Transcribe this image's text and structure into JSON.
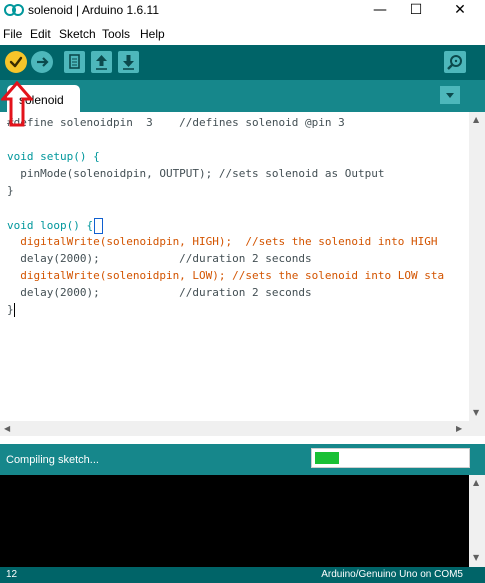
{
  "window": {
    "title": "solenoid | Arduino 1.6.11",
    "minimize_glyph": "—",
    "maximize_glyph": "☐",
    "close_glyph": "✕"
  },
  "menu": {
    "file": "File",
    "edit": "Edit",
    "sketch": "Sketch",
    "tools": "Tools",
    "help": "Help"
  },
  "toolbar": {
    "icons": [
      "checkmark-icon",
      "arrow-right-icon",
      "new-file-icon",
      "open-up-arrow-icon",
      "save-down-arrow-icon",
      "magnifier-icon"
    ]
  },
  "tabs": [
    {
      "label": "solenoid"
    }
  ],
  "editor": {
    "lines": [
      "#define solenoidpin  3    //defines solenoid @pin 3",
      "",
      "void setup() {",
      "  pinMode(solenoidpin, OUTPUT); //sets solenoid as Output",
      "}",
      "",
      "void loop() {",
      "  digitalWrite(solenoidpin, HIGH);  //sets the solenoid into HIGH",
      "  delay(2000);            //duration 2 seconds",
      "  digitalWrite(solenoidpin, LOW); //sets the solenoid into LOW sta",
      "  delay(2000);            //duration 2 seconds",
      "}"
    ]
  },
  "status": {
    "message": "Compiling sketch...",
    "progress": 0.16
  },
  "footer": {
    "line_number": "12",
    "board": "Arduino/Genuino Uno on COM5"
  },
  "colors": {
    "toolbar": "#006468",
    "tabbar": "#16878b",
    "verify_button": "#f6c52a",
    "button": "#4db7bb",
    "progress_fill": "#19c035",
    "annotation": "#e3131b"
  }
}
